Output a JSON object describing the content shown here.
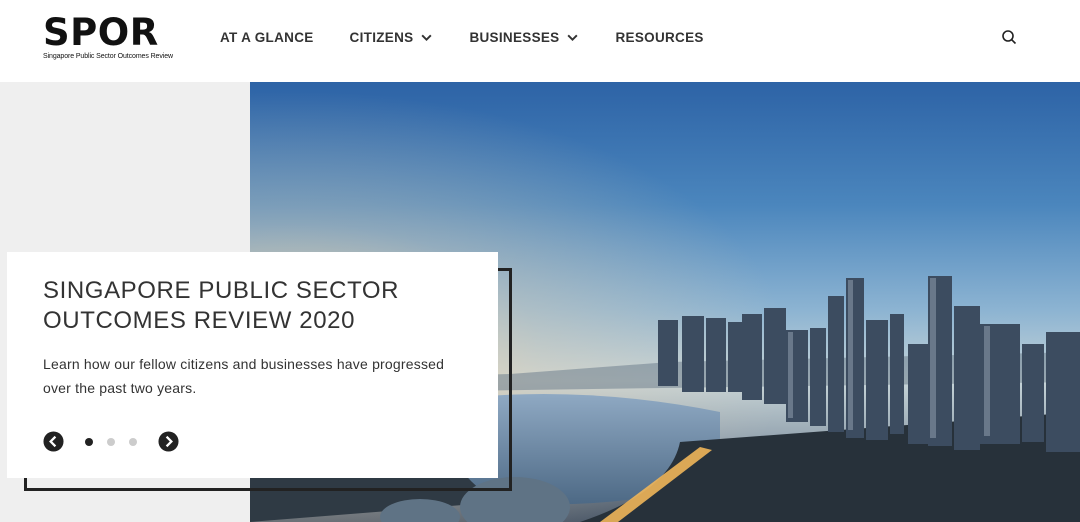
{
  "logo": {
    "word": "SPOR",
    "tagline": "Singapore Public Sector Outcomes Review"
  },
  "nav": {
    "items": [
      {
        "label": "AT A GLANCE"
      },
      {
        "label": "CITIZENS"
      },
      {
        "label": "BUSINESSES"
      },
      {
        "label": "RESOURCES"
      }
    ]
  },
  "icons": {
    "search": "search-icon",
    "chevron": "chevron-down-icon",
    "prev": "arrow-left-circle-icon",
    "next": "arrow-right-circle-icon"
  },
  "hero": {
    "title_line1": "SINGAPORE PUBLIC SECTOR",
    "title_line2": "OUTCOMES REVIEW 2020",
    "text_line1": "Learn how our fellow citizens and businesses have progressed",
    "text_line2": "over the past two years.",
    "slide_active": 1,
    "slide_count": 3
  },
  "colors": {
    "accent": "#222222",
    "dot_active": "#222222",
    "dot_inactive": "#cccccc",
    "side_panel": "#efefef"
  }
}
